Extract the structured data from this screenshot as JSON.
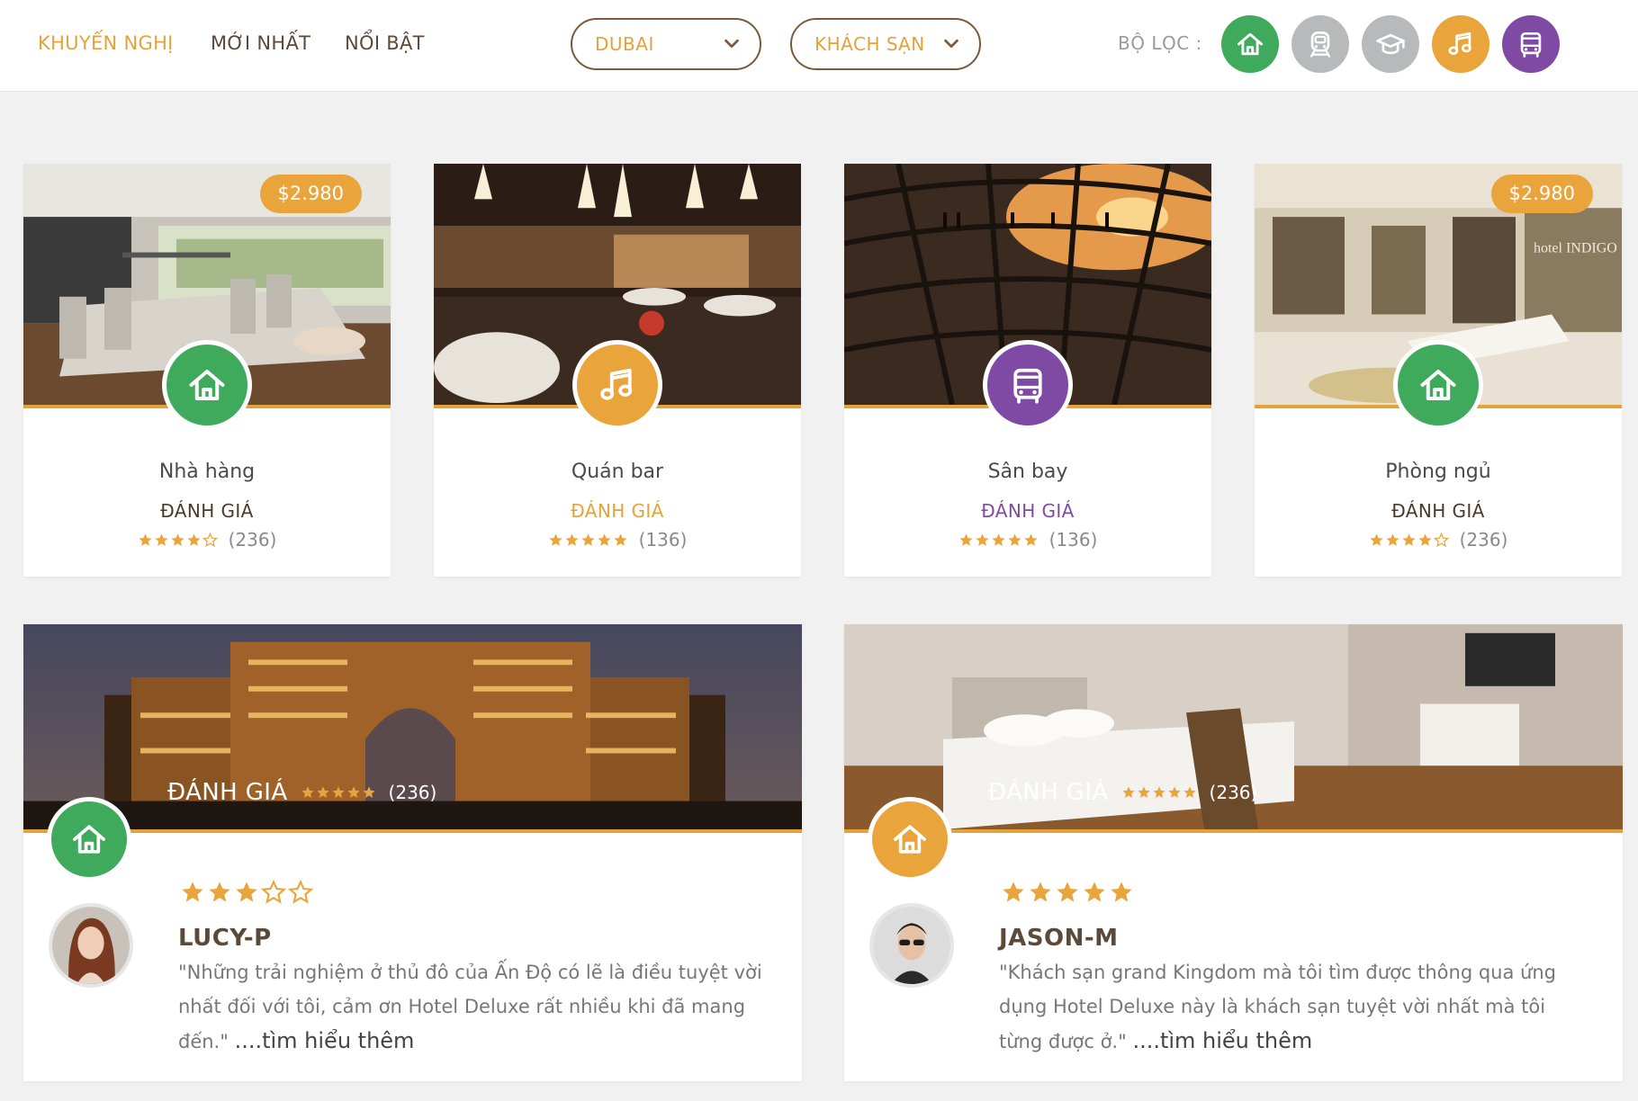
{
  "nav": {
    "recommended": "KHUYẾN NGHỊ",
    "newest": "MỚI NHẤT",
    "featured": "NỔI BẬT"
  },
  "location_select": {
    "value": "DUBAI"
  },
  "type_select": {
    "value": "KHÁCH SẠN"
  },
  "filter": {
    "label": "BỘ LỌC :",
    "buttons": [
      {
        "icon": "home-icon",
        "color": "#3fa95c",
        "active": true
      },
      {
        "icon": "train-icon",
        "color": "#b7b9ba",
        "active": false
      },
      {
        "icon": "graduation-cap-icon",
        "color": "#b7b9ba",
        "active": false
      },
      {
        "icon": "music-icon",
        "color": "#e9a43c",
        "active": true
      },
      {
        "icon": "bus-icon",
        "color": "#7f4aa3",
        "active": true
      }
    ]
  },
  "colors": {
    "accent": "#e4a23a",
    "green": "#3fa95c",
    "orange": "#e9a43c",
    "purple": "#7f4aa3",
    "brown": "#5b4a3a"
  },
  "cards": [
    {
      "title": "Nhà hàng",
      "rating_label": "ĐÁNH GIÁ",
      "rating": 4,
      "count": "(236)",
      "price": "$2.980",
      "icon": "home-icon",
      "color": "#3fa95c",
      "label_color": "#4a3a2a"
    },
    {
      "title": "Quán bar",
      "rating_label": "ĐÁNH GIÁ",
      "rating": 5,
      "count": "(136)",
      "price": "",
      "icon": "music-icon",
      "color": "#e9a43c",
      "label_color": "#e4a23a"
    },
    {
      "title": "Sân bay",
      "rating_label": "ĐÁNH GIÁ",
      "rating": 5,
      "count": "(136)",
      "price": "",
      "icon": "bus-icon",
      "color": "#7f4aa3",
      "label_color": "#7f4aa3"
    },
    {
      "title": "Phòng ngủ",
      "rating_label": "ĐÁNH GIÁ",
      "rating": 4,
      "count": "(236)",
      "price": "$2.980",
      "icon": "home-icon",
      "color": "#3fa95c",
      "label_color": "#4a3a2a"
    }
  ],
  "reviews": [
    {
      "overlay_label": "ĐÁNH GIÁ",
      "overlay_rating": 5,
      "overlay_count": "(236)",
      "icon": "home-icon",
      "color": "#3fa95c",
      "rating": 3,
      "user": "LUCY-P",
      "text": "\"Những trải nghiệm ở thủ đô của Ấn Độ có lẽ là điều tuyệt vời nhất đối với tôi, cảm ơn Hotel Deluxe rất nhiều khi đã mang đến.\" ",
      "more": "....tìm hiểu thêm"
    },
    {
      "overlay_label": "ĐÁNH GIÁ",
      "overlay_rating": 5,
      "overlay_count": "(236)",
      "icon": "home-icon",
      "color": "#e9a43c",
      "rating": 5,
      "user": "JASON-M",
      "text": "\"Khách sạn grand Kingdom mà tôi tìm được thông qua ứng dụng Hotel Deluxe này là khách sạn tuyệt vời nhất mà tôi từng được ở.\" ",
      "more": "....tìm hiểu thêm"
    }
  ]
}
